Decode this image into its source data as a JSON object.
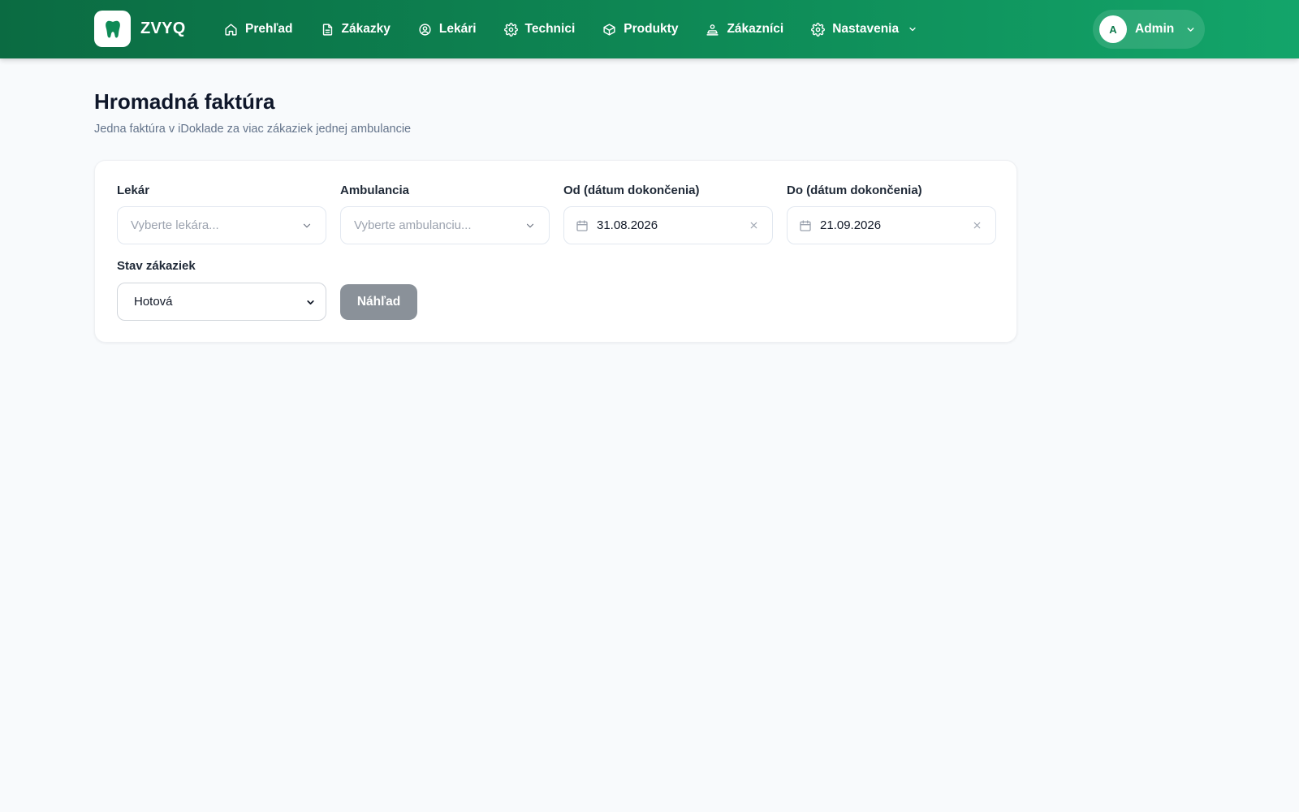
{
  "app": {
    "brand": "ZVYQ",
    "nav": [
      {
        "label": "Prehľad",
        "icon": "home-icon"
      },
      {
        "label": "Zákazky",
        "icon": "document-icon"
      },
      {
        "label": "Lekári",
        "icon": "user-circle-icon"
      },
      {
        "label": "Technici",
        "icon": "gear-icon"
      },
      {
        "label": "Produkty",
        "icon": "box-icon"
      },
      {
        "label": "Zákazníci",
        "icon": "customer-icon"
      },
      {
        "label": "Nastavenia",
        "icon": "gear-icon"
      }
    ],
    "user": {
      "initial": "A",
      "name": "Admin"
    }
  },
  "page": {
    "title": "Hromadná faktúra",
    "subtitle": "Jedna faktúra v iDoklade za viac zákaziek jednej ambulancie"
  },
  "form": {
    "doctor": {
      "label": "Lekár",
      "placeholder": "Vyberte lekára..."
    },
    "clinic": {
      "label": "Ambulancia",
      "placeholder": "Vyberte ambulanciu..."
    },
    "date_from": {
      "label": "Od (dátum dokončenia)",
      "value": "31.08.2026"
    },
    "date_to": {
      "label": "Do (dátum dokončenia)",
      "value": "21.09.2026"
    },
    "status": {
      "label": "Stav zákaziek",
      "value": "Hotová"
    },
    "preview_button": "Náhľad"
  },
  "colors": {
    "header_start": "#0b6b42",
    "header_end": "#13a56a",
    "button_disabled": "#8a9199",
    "background": "#f8fafc"
  }
}
